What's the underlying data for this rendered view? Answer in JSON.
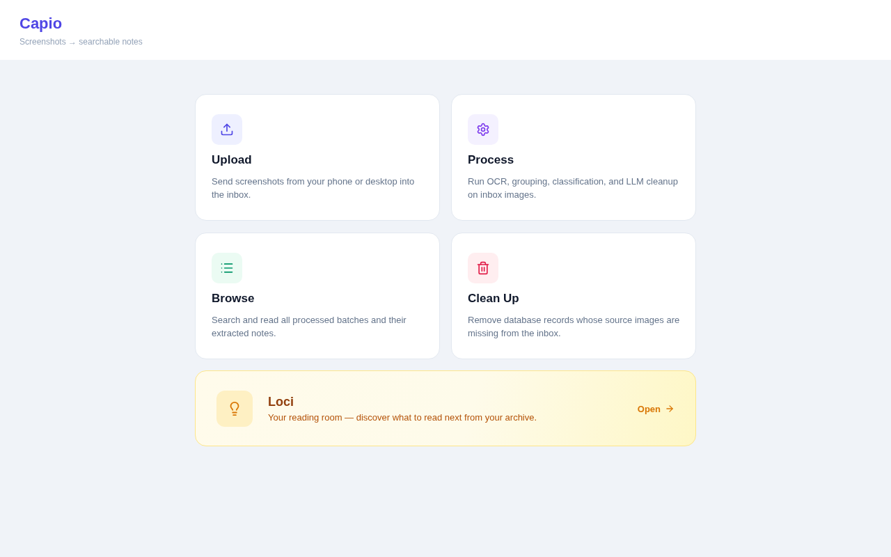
{
  "header": {
    "title": "Capio",
    "subtitle": "Screenshots → searchable notes"
  },
  "cards": [
    {
      "kind": "upload",
      "title": "Upload",
      "description": "Send screenshots from your phone or desktop into the inbox."
    },
    {
      "kind": "process",
      "title": "Process",
      "description": "Run OCR, grouping, classification, and LLM cleanup on inbox images."
    },
    {
      "kind": "browse",
      "title": "Browse",
      "description": "Search and read all processed batches and their extracted notes."
    },
    {
      "kind": "cleanup",
      "title": "Clean Up",
      "description": "Remove database records whose source images are missing from the inbox."
    }
  ],
  "banner": {
    "title": "Loci",
    "description": "Your reading room — discover what to read next from your archive.",
    "action": "Open"
  }
}
